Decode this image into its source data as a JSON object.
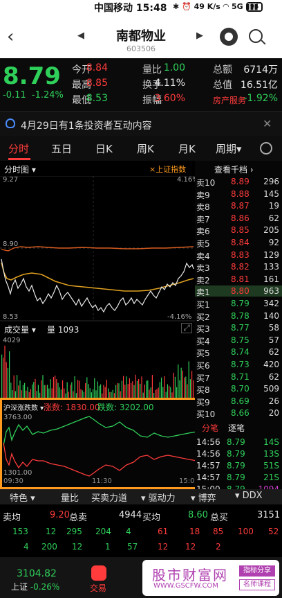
{
  "status_bar": {
    "carrier": "中国移动",
    "time": "15:48",
    "speed": "49 K/s",
    "network": "5G",
    "battery": "94"
  },
  "header": {
    "title": "南都物业",
    "code": "603506"
  },
  "quote": {
    "price": "8.79",
    "change": "-0.11",
    "change_pct": "-1.24%",
    "fields": [
      {
        "label": "今开",
        "value": "8.84",
        "color": "red"
      },
      {
        "label": "量比",
        "value": "1.00",
        "color": "green"
      },
      {
        "label": "总额",
        "value": "6714万",
        "color": "white"
      },
      {
        "label": "最高",
        "value": "8.85",
        "color": "red"
      },
      {
        "label": "换手",
        "value": "4.11%",
        "color": "white"
      },
      {
        "label": "总值",
        "value": "16.51亿",
        "color": "white"
      },
      {
        "label": "最低",
        "value": "8.53",
        "color": "green"
      },
      {
        "label": "振幅",
        "value": "3.60%",
        "color": "red"
      },
      {
        "label": "房产服务",
        "value": "-1.92%",
        "color": "green"
      }
    ]
  },
  "notice": {
    "text": "4月29日有1条投资者互动内容"
  },
  "tabs": [
    {
      "label": "分时",
      "active": true
    },
    {
      "label": "五日",
      "active": false
    },
    {
      "label": "日K",
      "active": false
    },
    {
      "label": "周K",
      "active": false
    },
    {
      "label": "月K",
      "active": false
    },
    {
      "label": "周期▾",
      "active": false
    }
  ],
  "chart": {
    "title": "分时图 ▾",
    "overlay": "×上证指数",
    "top_price": "9.27",
    "top_pct": "4.16%",
    "mid_price": "8.90",
    "bottom_price": "8.53",
    "bottom_pct": "-4.16%"
  },
  "volume": {
    "title": "成交量 ▾",
    "amount_label": "量",
    "amount": "1093",
    "max": "4029"
  },
  "index_box": {
    "title": "沪深涨跌数 ▾",
    "up_label": "涨数: 1830.00",
    "down_label": "跌数: 3202.00",
    "top_val": "3763.00",
    "bottom_val": "1301.00",
    "t_start": "09:30",
    "t_mid": "11:30",
    "t_end": "15:00"
  },
  "book": {
    "title": "查看千档 ›",
    "asks": [
      {
        "label": "卖10",
        "price": "8.89",
        "vol": "296"
      },
      {
        "label": "卖9",
        "price": "8.88",
        "vol": "145"
      },
      {
        "label": "卖8",
        "price": "8.87",
        "vol": "19"
      },
      {
        "label": "卖7",
        "price": "8.86",
        "vol": "62"
      },
      {
        "label": "卖6",
        "price": "8.85",
        "vol": "205"
      },
      {
        "label": "卖5",
        "price": "8.84",
        "vol": "92"
      },
      {
        "label": "卖4",
        "price": "8.83",
        "vol": "129"
      },
      {
        "label": "卖3",
        "price": "8.82",
        "vol": "133"
      },
      {
        "label": "卖2",
        "price": "8.81",
        "vol": "161"
      },
      {
        "label": "卖1",
        "price": "8.80",
        "vol": "963"
      }
    ],
    "bids": [
      {
        "label": "买1",
        "price": "8.79",
        "vol": "342"
      },
      {
        "label": "买2",
        "price": "8.78",
        "vol": "140"
      },
      {
        "label": "买3",
        "price": "8.77",
        "vol": "58"
      },
      {
        "label": "买4",
        "price": "8.75",
        "vol": "57"
      },
      {
        "label": "买5",
        "price": "8.74",
        "vol": "62"
      },
      {
        "label": "买6",
        "price": "8.73",
        "vol": "420"
      },
      {
        "label": "买7",
        "price": "8.71",
        "vol": "62"
      },
      {
        "label": "买8",
        "price": "8.70",
        "vol": "509"
      },
      {
        "label": "买9",
        "price": "8.69",
        "vol": "26"
      },
      {
        "label": "买10",
        "price": "8.66",
        "vol": "20"
      }
    ],
    "sub_tabs": [
      "分笔",
      "逐笔"
    ],
    "ticks": [
      {
        "time": "14:56",
        "price": "8.79",
        "vol": "14",
        "side": "S"
      },
      {
        "time": "14:56",
        "price": "8.79",
        "vol": "13",
        "side": "S"
      },
      {
        "time": "14:57",
        "price": "8.79",
        "vol": "51",
        "side": "S"
      },
      {
        "time": "14:57",
        "price": "8.79",
        "vol": "21",
        "side": "S"
      },
      {
        "time": "15:00",
        "price": "8.79",
        "vol": "1094",
        "side": ""
      }
    ]
  },
  "features": [
    "特色 ▾",
    "量比",
    "买卖力道",
    "▾ 驱动力",
    "▾ 博弈",
    "▾ DDX"
  ],
  "summary": {
    "sell_avg_label": "卖均",
    "sell_avg": "9.20",
    "sell_total_label": "总卖",
    "sell_total": "4944",
    "buy_avg_label": "买均",
    "buy_avg": "8.60",
    "buy_total_label": "总买",
    "buy_total": "3151"
  },
  "grid": {
    "row1": [
      "153",
      "12",
      "295",
      "204",
      "4",
      "61",
      "18",
      "85",
      "100",
      "52"
    ],
    "row2": [
      "4",
      "200",
      "12",
      "1",
      "57",
      "12",
      "12",
      "2"
    ]
  },
  "bottom": {
    "index_value": "3104.82",
    "index_label": "上证",
    "index_change": "-0.26%",
    "trade_label": "交易"
  },
  "watermark": {
    "title": "股市财富网",
    "url": "WWW.GSCFW.COM",
    "badge1": "指标分享",
    "badge2": "名师课程"
  }
}
